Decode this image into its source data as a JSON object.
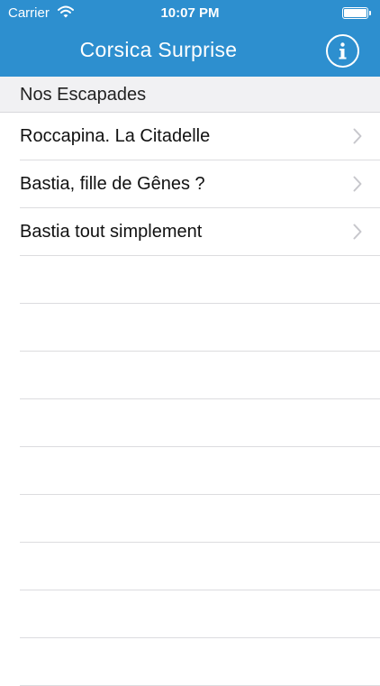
{
  "status_bar": {
    "carrier": "Carrier",
    "time": "10:07 PM"
  },
  "nav": {
    "title": "Corsica Surprise"
  },
  "section": {
    "title": "Nos Escapades"
  },
  "items": [
    {
      "label": "Roccapina. La Citadelle"
    },
    {
      "label": "Bastia, fille de Gênes ?"
    },
    {
      "label": "Bastia tout simplement"
    }
  ],
  "icons": {
    "info": "info-icon",
    "wifi": "wifi-icon",
    "battery": "battery-icon",
    "chevron": "chevron-right-icon"
  },
  "colors": {
    "header_bg": "#2d8fcf",
    "section_bg": "#f1f1f3",
    "separator": "#dcdcdf",
    "chevron": "#c7c7cc"
  }
}
